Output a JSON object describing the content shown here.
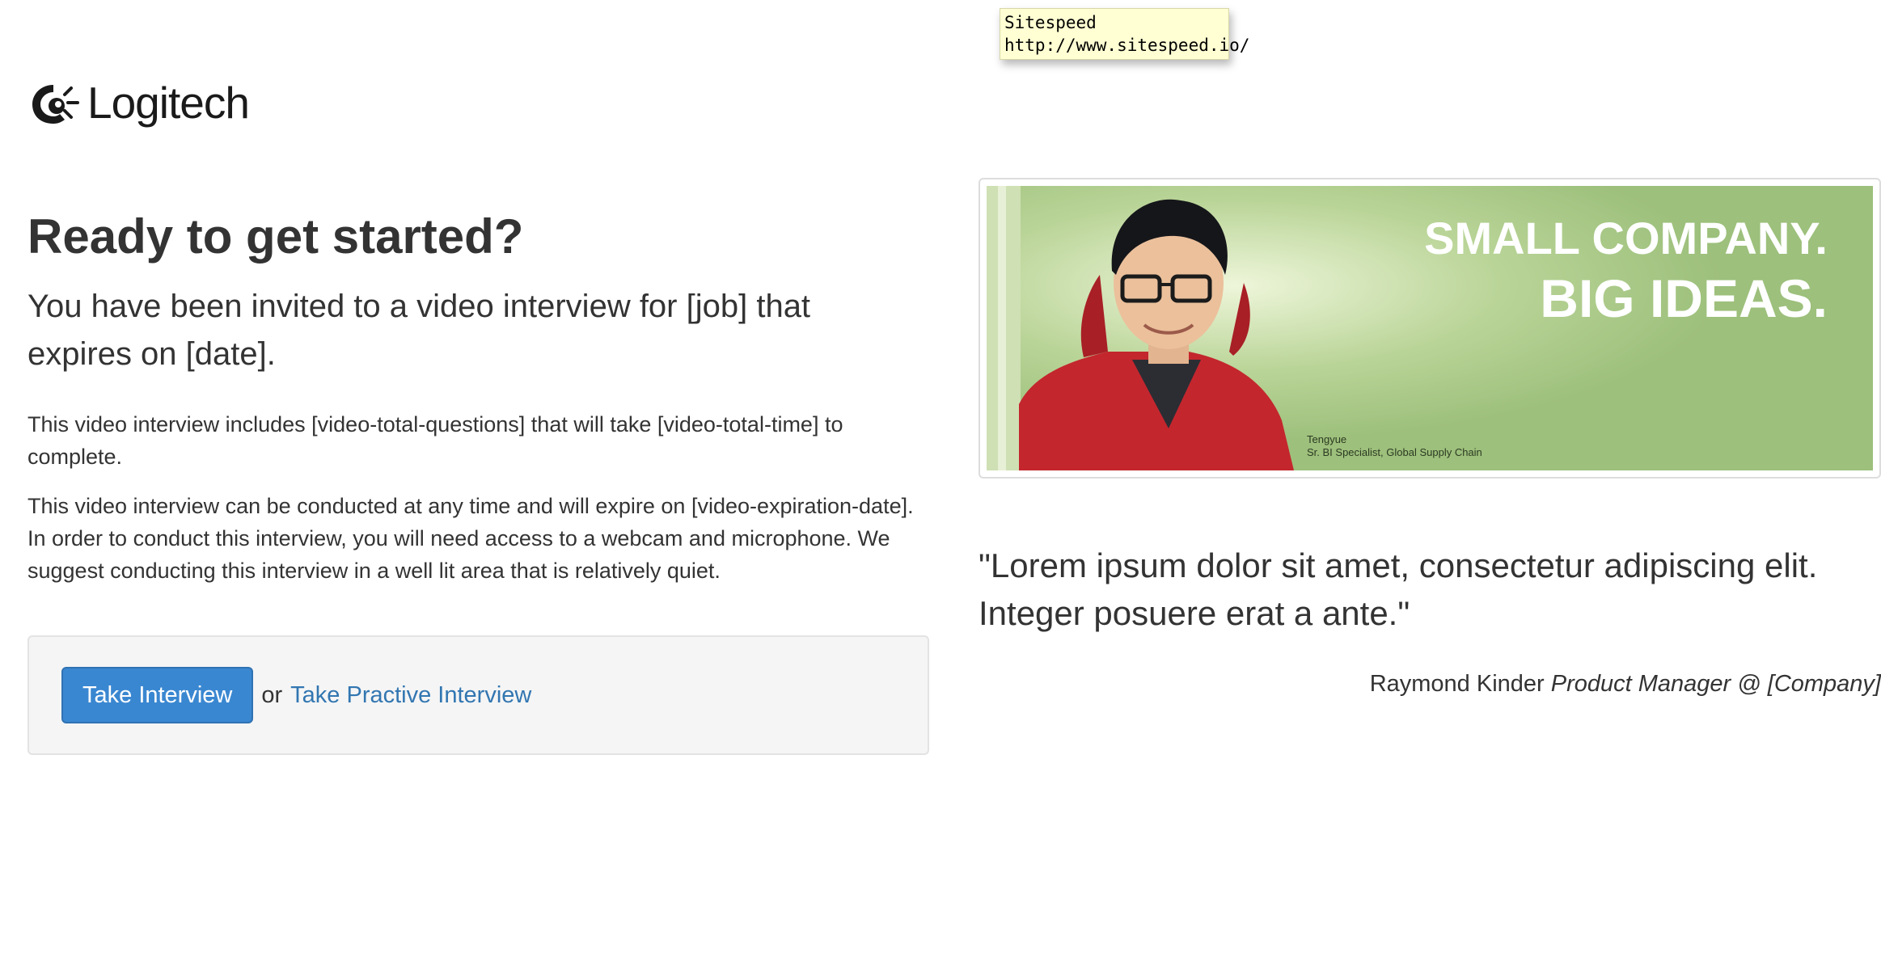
{
  "tooltip": {
    "title": "Sitespeed",
    "url": "http://www.sitespeed.io/"
  },
  "logo": {
    "icon": "logitech-logo-icon",
    "wordmark": "Logitech"
  },
  "main": {
    "heading": "Ready to get started?",
    "lead": "You have been invited to a video interview for [job] that expires on [date].",
    "paragraph1": "This video interview includes [video-total-questions] that will take [video-total-time] to complete.",
    "paragraph2": "This video interview can be conducted at any time and will expire on [video-expiration-date]. In order to conduct this interview, you will need access to a webcam and microphone. We suggest conducting this interview in a well lit area that is relatively quiet.",
    "take_interview_label": "Take Interview",
    "or_text": "or",
    "practice_link": "Take Practive Interview"
  },
  "banner": {
    "headline_line1": "SMALL COMPANY.",
    "headline_line2": "BIG IDEAS.",
    "person_name": "Tengyue",
    "person_title": "Sr. BI Specialist, Global Supply Chain",
    "bg_color": "#9dc07c",
    "text_color": "#ffffff"
  },
  "testimonial": {
    "quote": "\"Lorem ipsum dolor sit amet, consectetur adipiscing elit. Integer posuere erat a ante.\"",
    "author": "Raymond Kinder",
    "role": "Product Manager @ [Company]"
  },
  "colors": {
    "primary_button": "#3a87d1",
    "link": "#3276b1",
    "well_bg": "#f5f5f5",
    "tooltip_bg": "#ffffd3"
  }
}
